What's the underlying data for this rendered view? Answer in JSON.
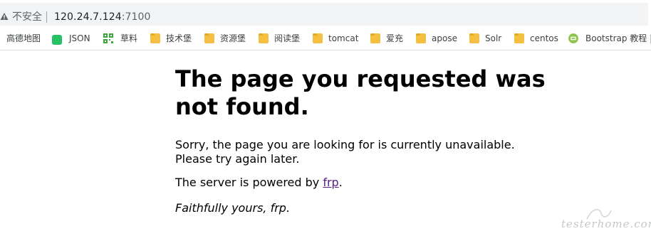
{
  "address_bar": {
    "security_label": "不安全",
    "url_host": "120.24.7.124",
    "url_port": ":7100"
  },
  "bookmarks": [
    {
      "label": "高德地图",
      "icon": "cut-off-icon"
    },
    {
      "label": "JSON",
      "icon": "json-icon"
    },
    {
      "label": "草料",
      "icon": "qr-grass-icon"
    },
    {
      "label": "技术堡",
      "icon": "folder-icon"
    },
    {
      "label": "资源堡",
      "icon": "folder-icon"
    },
    {
      "label": "阅读堡",
      "icon": "folder-icon"
    },
    {
      "label": "tomcat",
      "icon": "folder-icon"
    },
    {
      "label": "爱充",
      "icon": "folder-icon"
    },
    {
      "label": "apose",
      "icon": "folder-icon"
    },
    {
      "label": "Solr",
      "icon": "folder-icon"
    },
    {
      "label": "centos",
      "icon": "folder-icon"
    },
    {
      "label": "Bootstrap 教程 |",
      "icon": "bootstrap-icon"
    }
  ],
  "page": {
    "heading": "The page you requested was not found.",
    "sorry_line1": "Sorry, the page you are looking for is currently unavailable.",
    "sorry_line2": "Please try again later.",
    "powered_prefix": "The server is powered by ",
    "powered_link": "frp",
    "powered_suffix": ".",
    "signature": "Faithfully yours, frp."
  },
  "watermark": "testerhome.com",
  "colors": {
    "omnibox_bg": "#f1f3f4",
    "link_visited": "#551a8b",
    "folder": "#f5c042",
    "json_green": "#27c16a"
  }
}
